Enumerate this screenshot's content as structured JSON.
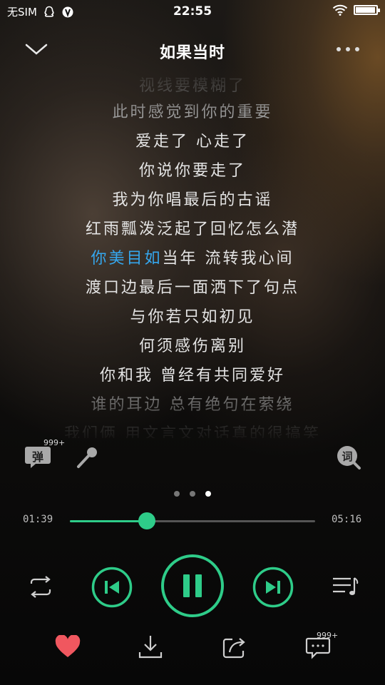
{
  "status_bar": {
    "carrier": "无SIM",
    "time": "22:55",
    "battery_level": 0.95
  },
  "header": {
    "title": "如果当时"
  },
  "lyrics": {
    "lines": [
      "视线要模糊了",
      "此时感觉到你的重要",
      "爱走了  心走了",
      "你说你要走了",
      "我为你唱最后的古谣",
      "红雨瓢泼泛起了回忆怎么潜",
      "你美目如当年  流转我心间",
      "渡口边最后一面洒下了句点",
      "与你若只如初见",
      "何须感伤离别",
      "你和我  曾经有共同爱好",
      "谁的耳边  总有绝句在萦绕",
      "我们俩  用文言文对话真的很搞笑"
    ],
    "current_index": 6,
    "current_highlight": "你美目如",
    "current_rest": "当年  流转我心间"
  },
  "tools": {
    "danmaku_label": "弹",
    "danmaku_count": "999+",
    "lyric_icon_label": "词"
  },
  "pager": {
    "count": 3,
    "active": 2
  },
  "progress": {
    "elapsed": "01:39",
    "total": "05:16",
    "fraction": 0.3133
  },
  "bottom": {
    "comment_count": "999+"
  },
  "colors": {
    "accent": "#2ecc89",
    "lyric_highlight": "#35a7ee",
    "like": "#f0575f"
  }
}
